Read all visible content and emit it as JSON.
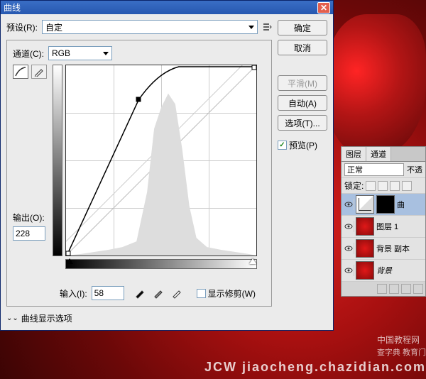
{
  "dialog": {
    "title": "曲线",
    "preset_label": "预设(R):",
    "preset_value": "自定",
    "channel_label": "通道(C):",
    "channel_value": "RGB",
    "output_label": "输出(O):",
    "output_value": "228",
    "input_label": "输入(I):",
    "input_value": "58",
    "show_clip_label": "显示修剪(W)",
    "expand_label": "曲线显示选项",
    "curve_point": {
      "x_pct": 38,
      "y_pct": 18
    },
    "black_slider_pct": 2,
    "white_slider_pct": 98
  },
  "buttons": {
    "ok": "确定",
    "cancel": "取消",
    "smooth": "平滑(M)",
    "auto": "自动(A)",
    "options": "选项(T)...",
    "preview": "预览(P)"
  },
  "layers_panel": {
    "tab_layers": "图层",
    "tab_channels": "通道",
    "blend_mode": "正常",
    "opacity_label": "不透",
    "lock_label": "锁定:",
    "items": [
      {
        "name": "曲"
      },
      {
        "name": "图层 1"
      },
      {
        "name": "背景 副本"
      },
      {
        "name": "背景"
      }
    ]
  },
  "watermark": {
    "cn": "中国教程网",
    "sub": "查字典    教育门",
    "en": "JCW jiaocheng.chazidian.com"
  },
  "chart_data": {
    "type": "line",
    "title": "Curves",
    "xlabel": "输入",
    "ylabel": "输出",
    "xlim": [
      0,
      255
    ],
    "ylim": [
      0,
      255
    ],
    "series": [
      {
        "name": "curve",
        "x": [
          0,
          58,
          150,
          255
        ],
        "y": [
          0,
          228,
          255,
          255
        ]
      },
      {
        "name": "identity",
        "x": [
          0,
          255
        ],
        "y": [
          0,
          255
        ]
      }
    ],
    "histogram_peak_region": [
      110,
      170
    ]
  }
}
